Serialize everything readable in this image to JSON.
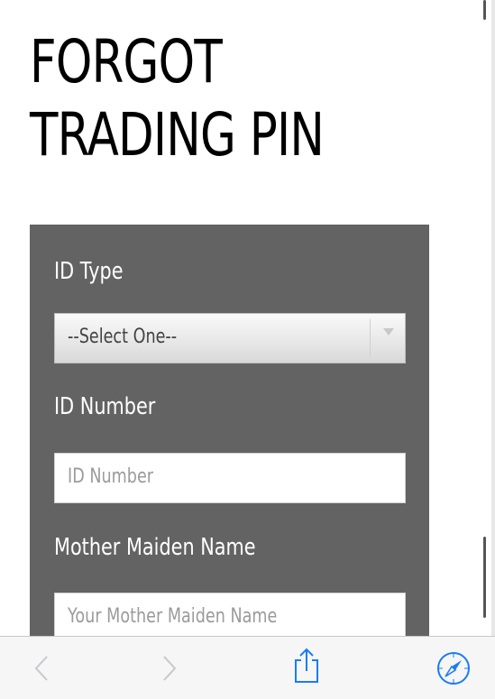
{
  "page": {
    "title_line1": "FORGOT",
    "title_line2": "TRADING PIN"
  },
  "form": {
    "id_type": {
      "label": "ID Type",
      "selected": "--Select One--"
    },
    "id_number": {
      "label": "ID Number",
      "placeholder": "ID Number"
    },
    "mother_maiden_name": {
      "label": "Mother Maiden Name",
      "placeholder": "Your Mother Maiden Name"
    }
  },
  "toolbar": {
    "icons": [
      "chevron-left-icon",
      "chevron-right-icon",
      "share-icon",
      "compass-icon"
    ],
    "accent": "#1a7cf5",
    "disabled": "#c7c7cc"
  },
  "colors": {
    "panel": "#636363",
    "label": "#ffffff"
  }
}
